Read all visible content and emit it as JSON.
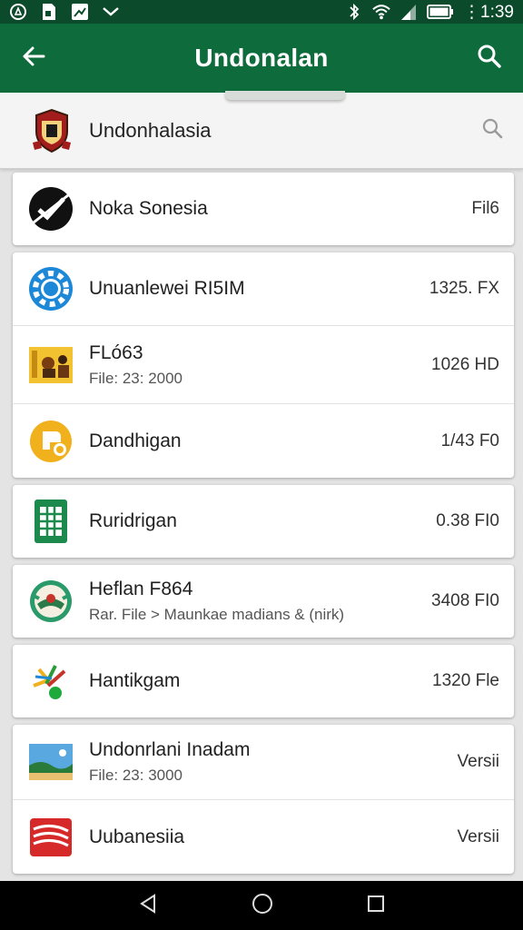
{
  "status_bar": {
    "time": "⋮1:39",
    "left_icons": [
      "notification-icon",
      "file-icon",
      "image-icon",
      "signal-mute-icon"
    ],
    "right_icons": [
      "bluetooth-icon",
      "wifi-icon",
      "cell-signal-icon",
      "battery-icon"
    ]
  },
  "app_bar": {
    "title": "Undonalan",
    "back_icon": "arrow-back-icon",
    "search_icon": "search-icon"
  },
  "search_bar": {
    "title": "Undonhalasia",
    "logo_icon": "crest-logo-icon",
    "search_icon": "search-icon"
  },
  "items": [
    {
      "name": "Noka Sonesia",
      "sub": "",
      "meta": "Fil6",
      "icon": "check-circle-icon"
    },
    {
      "name": "Unuanlewei RI5IM",
      "sub": "",
      "meta": "1325. FX",
      "icon": "poker-chip-icon"
    },
    {
      "name": "FLó63",
      "sub": "File: 23: 2000",
      "meta": "1026 HD",
      "icon": "game-image-icon"
    },
    {
      "name": "Dandhigan",
      "sub": "",
      "meta": "1/43 F0",
      "icon": "yellow-badge-icon"
    },
    {
      "name": "Ruridrigan",
      "sub": "",
      "meta": "0.38 FI0",
      "icon": "spreadsheet-icon"
    },
    {
      "name": "Heflan F864",
      "sub": "Rar. File > Maunkae madians & (nirk)",
      "meta": "3408 FI0",
      "icon": "emblem-icon"
    },
    {
      "name": "Hantikgam",
      "sub": "",
      "meta": "1320 Fle",
      "icon": "sparkle-icon"
    },
    {
      "name": "Undonrlani Inadam",
      "sub": "File: 23: 3000",
      "meta": "Versii",
      "icon": "landscape-icon"
    },
    {
      "name": "Uubanesiia",
      "sub": "",
      "meta": "Versii",
      "icon": "red-flag-icon"
    }
  ],
  "nav_bar": {
    "back": "back-triangle-icon",
    "home": "home-circle-icon",
    "recents": "recents-square-icon"
  },
  "colors": {
    "status_bar": "#0b4a2b",
    "app_bar": "#0e6b3c",
    "background": "#e4e4e4"
  }
}
